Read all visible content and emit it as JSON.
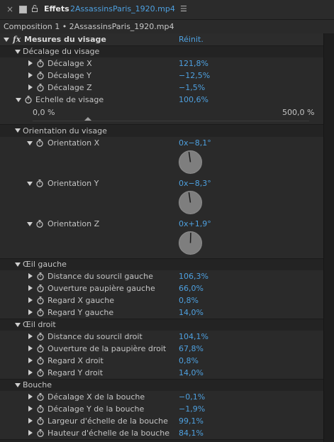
{
  "title_bar": {
    "panel_label": "Effets",
    "file_name": "2AssassinsParis_1920.mp4"
  },
  "comp_line": "Composition 1 • 2AssassinsParis_1920.mp4",
  "effect": {
    "name": "Mesures du visage",
    "reset": "Réinit."
  },
  "groups": {
    "decalage_visage": "Décalage du visage",
    "orientation_visage": "Orientation du visage",
    "oeil_gauche": "Œil gauche",
    "oeil_droit": "Œil droit",
    "bouche": "Bouche"
  },
  "props": {
    "decalage_x": {
      "label": "Décalage X",
      "value": "121,8%"
    },
    "decalage_y": {
      "label": "Décalage Y",
      "value": "−12,5%"
    },
    "decalage_z": {
      "label": "Décalage Z",
      "value": "−1,5%"
    },
    "echelle": {
      "label": "Echelle de visage",
      "value": "100,6%",
      "min": "0,0 %",
      "max": "500,0 %",
      "level": 0.2012
    },
    "orient_x": {
      "label": "Orientation X",
      "value": "0x−8,1°",
      "angle": -8.1
    },
    "orient_y": {
      "label": "Orientation Y",
      "value": "0x−8,3°",
      "angle": -8.3
    },
    "orient_z": {
      "label": "Orientation Z",
      "value": "0x+1,9°",
      "angle": 1.9
    },
    "dist_sourcil_g": {
      "label": "Distance du sourcil gauche",
      "value": "106,3%"
    },
    "ouv_paup_g": {
      "label": "Ouverture paupière gauche",
      "value": "66,0%"
    },
    "regard_x_g": {
      "label": "Regard X gauche",
      "value": "0,8%"
    },
    "regard_y_g": {
      "label": "Regard Y gauche",
      "value": "14,0%"
    },
    "dist_sourcil_d": {
      "label": "Distance du sourcil droit",
      "value": "104,1%"
    },
    "ouv_paup_d": {
      "label": "Ouverture de la paupière droit",
      "value": "67,8%"
    },
    "regard_x_d": {
      "label": "Regard X droit",
      "value": "0,8%"
    },
    "regard_y_d": {
      "label": "Regard Y droit",
      "value": "14,0%"
    },
    "dec_x_bouche": {
      "label": "Décalage X de la bouche",
      "value": "−0,1%"
    },
    "dec_y_bouche": {
      "label": "Décalage Y de la bouche",
      "value": "−1,9%"
    },
    "larg_bouche": {
      "label": "Largeur d'échelle de la bouche",
      "value": "99,1%"
    },
    "haut_bouche": {
      "label": "Hauteur d'échelle de la bouche",
      "value": "84,1%"
    }
  },
  "colors": {
    "value": "#4ea0df",
    "background": "#232323"
  }
}
